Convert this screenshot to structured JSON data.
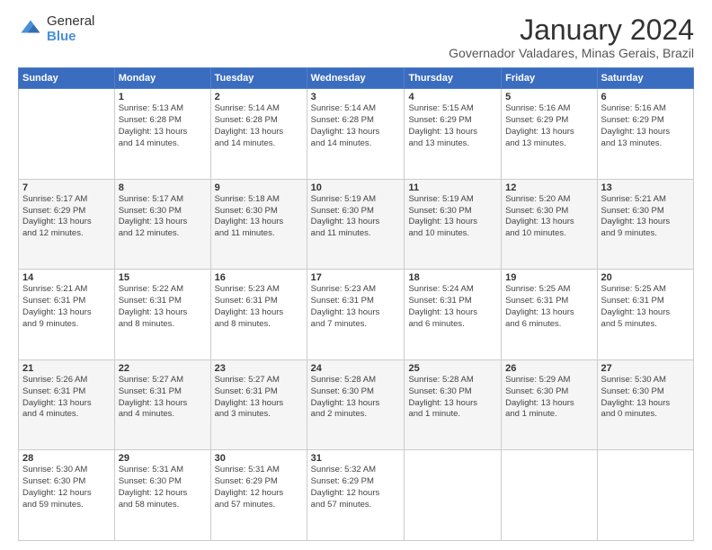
{
  "logo": {
    "general": "General",
    "blue": "Blue"
  },
  "title": "January 2024",
  "subtitle": "Governador Valadares, Minas Gerais, Brazil",
  "days_of_week": [
    "Sunday",
    "Monday",
    "Tuesday",
    "Wednesday",
    "Thursday",
    "Friday",
    "Saturday"
  ],
  "weeks": [
    [
      {
        "day": "",
        "info": ""
      },
      {
        "day": "1",
        "info": "Sunrise: 5:13 AM\nSunset: 6:28 PM\nDaylight: 13 hours\nand 14 minutes."
      },
      {
        "day": "2",
        "info": "Sunrise: 5:14 AM\nSunset: 6:28 PM\nDaylight: 13 hours\nand 14 minutes."
      },
      {
        "day": "3",
        "info": "Sunrise: 5:14 AM\nSunset: 6:28 PM\nDaylight: 13 hours\nand 14 minutes."
      },
      {
        "day": "4",
        "info": "Sunrise: 5:15 AM\nSunset: 6:29 PM\nDaylight: 13 hours\nand 13 minutes."
      },
      {
        "day": "5",
        "info": "Sunrise: 5:16 AM\nSunset: 6:29 PM\nDaylight: 13 hours\nand 13 minutes."
      },
      {
        "day": "6",
        "info": "Sunrise: 5:16 AM\nSunset: 6:29 PM\nDaylight: 13 hours\nand 13 minutes."
      }
    ],
    [
      {
        "day": "7",
        "info": "Sunrise: 5:17 AM\nSunset: 6:29 PM\nDaylight: 13 hours\nand 12 minutes."
      },
      {
        "day": "8",
        "info": "Sunrise: 5:17 AM\nSunset: 6:30 PM\nDaylight: 13 hours\nand 12 minutes."
      },
      {
        "day": "9",
        "info": "Sunrise: 5:18 AM\nSunset: 6:30 PM\nDaylight: 13 hours\nand 11 minutes."
      },
      {
        "day": "10",
        "info": "Sunrise: 5:19 AM\nSunset: 6:30 PM\nDaylight: 13 hours\nand 11 minutes."
      },
      {
        "day": "11",
        "info": "Sunrise: 5:19 AM\nSunset: 6:30 PM\nDaylight: 13 hours\nand 10 minutes."
      },
      {
        "day": "12",
        "info": "Sunrise: 5:20 AM\nSunset: 6:30 PM\nDaylight: 13 hours\nand 10 minutes."
      },
      {
        "day": "13",
        "info": "Sunrise: 5:21 AM\nSunset: 6:30 PM\nDaylight: 13 hours\nand 9 minutes."
      }
    ],
    [
      {
        "day": "14",
        "info": "Sunrise: 5:21 AM\nSunset: 6:31 PM\nDaylight: 13 hours\nand 9 minutes."
      },
      {
        "day": "15",
        "info": "Sunrise: 5:22 AM\nSunset: 6:31 PM\nDaylight: 13 hours\nand 8 minutes."
      },
      {
        "day": "16",
        "info": "Sunrise: 5:23 AM\nSunset: 6:31 PM\nDaylight: 13 hours\nand 8 minutes."
      },
      {
        "day": "17",
        "info": "Sunrise: 5:23 AM\nSunset: 6:31 PM\nDaylight: 13 hours\nand 7 minutes."
      },
      {
        "day": "18",
        "info": "Sunrise: 5:24 AM\nSunset: 6:31 PM\nDaylight: 13 hours\nand 6 minutes."
      },
      {
        "day": "19",
        "info": "Sunrise: 5:25 AM\nSunset: 6:31 PM\nDaylight: 13 hours\nand 6 minutes."
      },
      {
        "day": "20",
        "info": "Sunrise: 5:25 AM\nSunset: 6:31 PM\nDaylight: 13 hours\nand 5 minutes."
      }
    ],
    [
      {
        "day": "21",
        "info": "Sunrise: 5:26 AM\nSunset: 6:31 PM\nDaylight: 13 hours\nand 4 minutes."
      },
      {
        "day": "22",
        "info": "Sunrise: 5:27 AM\nSunset: 6:31 PM\nDaylight: 13 hours\nand 4 minutes."
      },
      {
        "day": "23",
        "info": "Sunrise: 5:27 AM\nSunset: 6:31 PM\nDaylight: 13 hours\nand 3 minutes."
      },
      {
        "day": "24",
        "info": "Sunrise: 5:28 AM\nSunset: 6:30 PM\nDaylight: 13 hours\nand 2 minutes."
      },
      {
        "day": "25",
        "info": "Sunrise: 5:28 AM\nSunset: 6:30 PM\nDaylight: 13 hours\nand 1 minute."
      },
      {
        "day": "26",
        "info": "Sunrise: 5:29 AM\nSunset: 6:30 PM\nDaylight: 13 hours\nand 1 minute."
      },
      {
        "day": "27",
        "info": "Sunrise: 5:30 AM\nSunset: 6:30 PM\nDaylight: 13 hours\nand 0 minutes."
      }
    ],
    [
      {
        "day": "28",
        "info": "Sunrise: 5:30 AM\nSunset: 6:30 PM\nDaylight: 12 hours\nand 59 minutes."
      },
      {
        "day": "29",
        "info": "Sunrise: 5:31 AM\nSunset: 6:30 PM\nDaylight: 12 hours\nand 58 minutes."
      },
      {
        "day": "30",
        "info": "Sunrise: 5:31 AM\nSunset: 6:29 PM\nDaylight: 12 hours\nand 57 minutes."
      },
      {
        "day": "31",
        "info": "Sunrise: 5:32 AM\nSunset: 6:29 PM\nDaylight: 12 hours\nand 57 minutes."
      },
      {
        "day": "",
        "info": ""
      },
      {
        "day": "",
        "info": ""
      },
      {
        "day": "",
        "info": ""
      }
    ]
  ]
}
